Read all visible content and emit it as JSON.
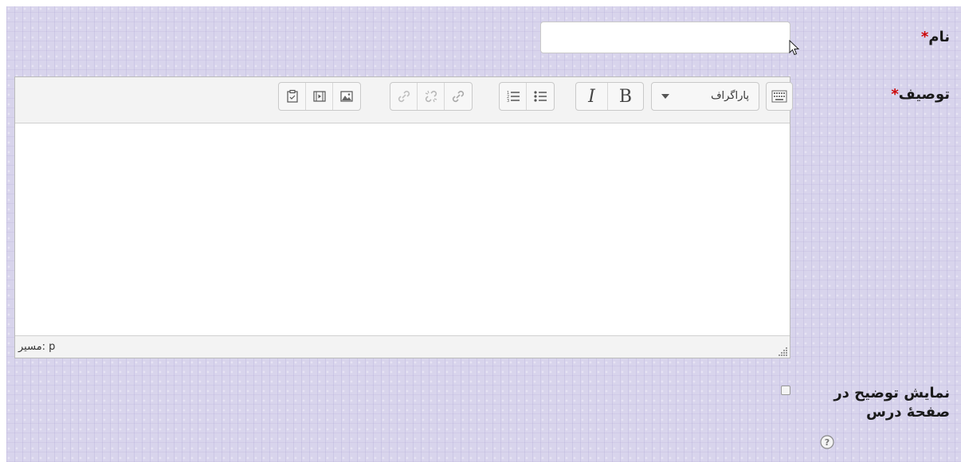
{
  "form": {
    "name_label": "نام",
    "name_value": "",
    "description_label": "توصیف",
    "required_marker": "*",
    "show_description_label": "نمایش توضیح در صفحهٔ درس",
    "show_description_checked": false
  },
  "editor": {
    "format_select": "پاراگراف",
    "toolbar_icons": [
      "keyboard-icon",
      "bold-icon",
      "italic-icon",
      "unordered-list-icon",
      "ordered-list-icon",
      "link-icon",
      "unlink-icon",
      "anchor-icon",
      "image-icon",
      "media-icon",
      "manage-files-icon"
    ],
    "bold_label": "B",
    "italic_label": "I",
    "content": "",
    "status_path": "مسیر: p"
  },
  "colors": {
    "panel_background": "#d8d4ec",
    "required": "#cc0000"
  }
}
